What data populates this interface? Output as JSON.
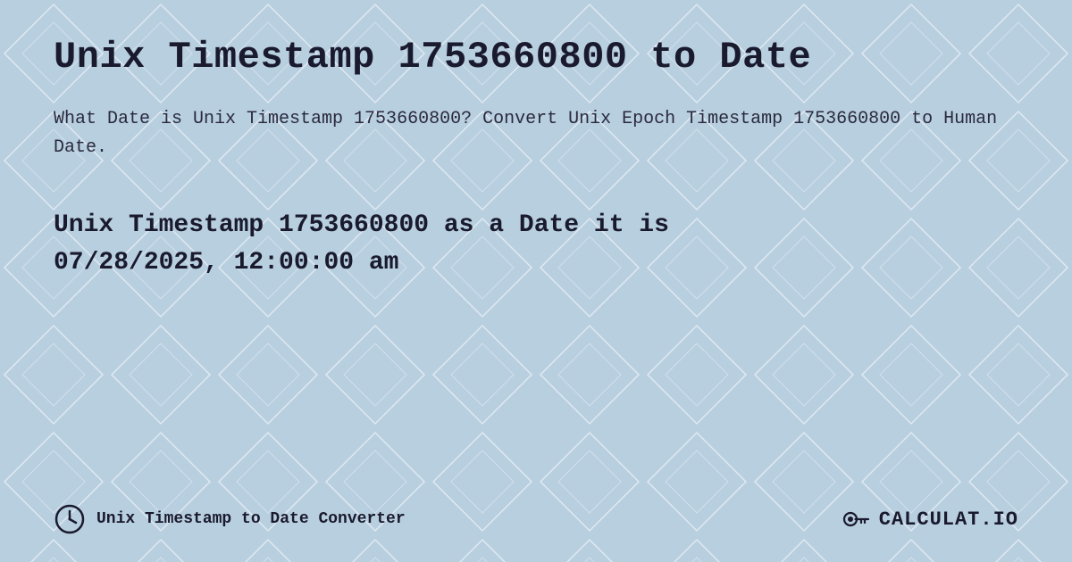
{
  "page": {
    "title": "Unix Timestamp 1753660800 to Date",
    "description": "What Date is Unix Timestamp 1753660800? Convert Unix Epoch Timestamp 1753660800 to Human Date.",
    "result_line1": "Unix Timestamp 1753660800 as a Date it is",
    "result_line2": "07/28/2025, 12:00:00 am",
    "footer_label": "Unix Timestamp to Date Converter",
    "logo_text": "CALCULAT.IO"
  },
  "colors": {
    "background": "#bdd0e0",
    "title_color": "#1a1a2e",
    "text_color": "#2a2a3e"
  }
}
